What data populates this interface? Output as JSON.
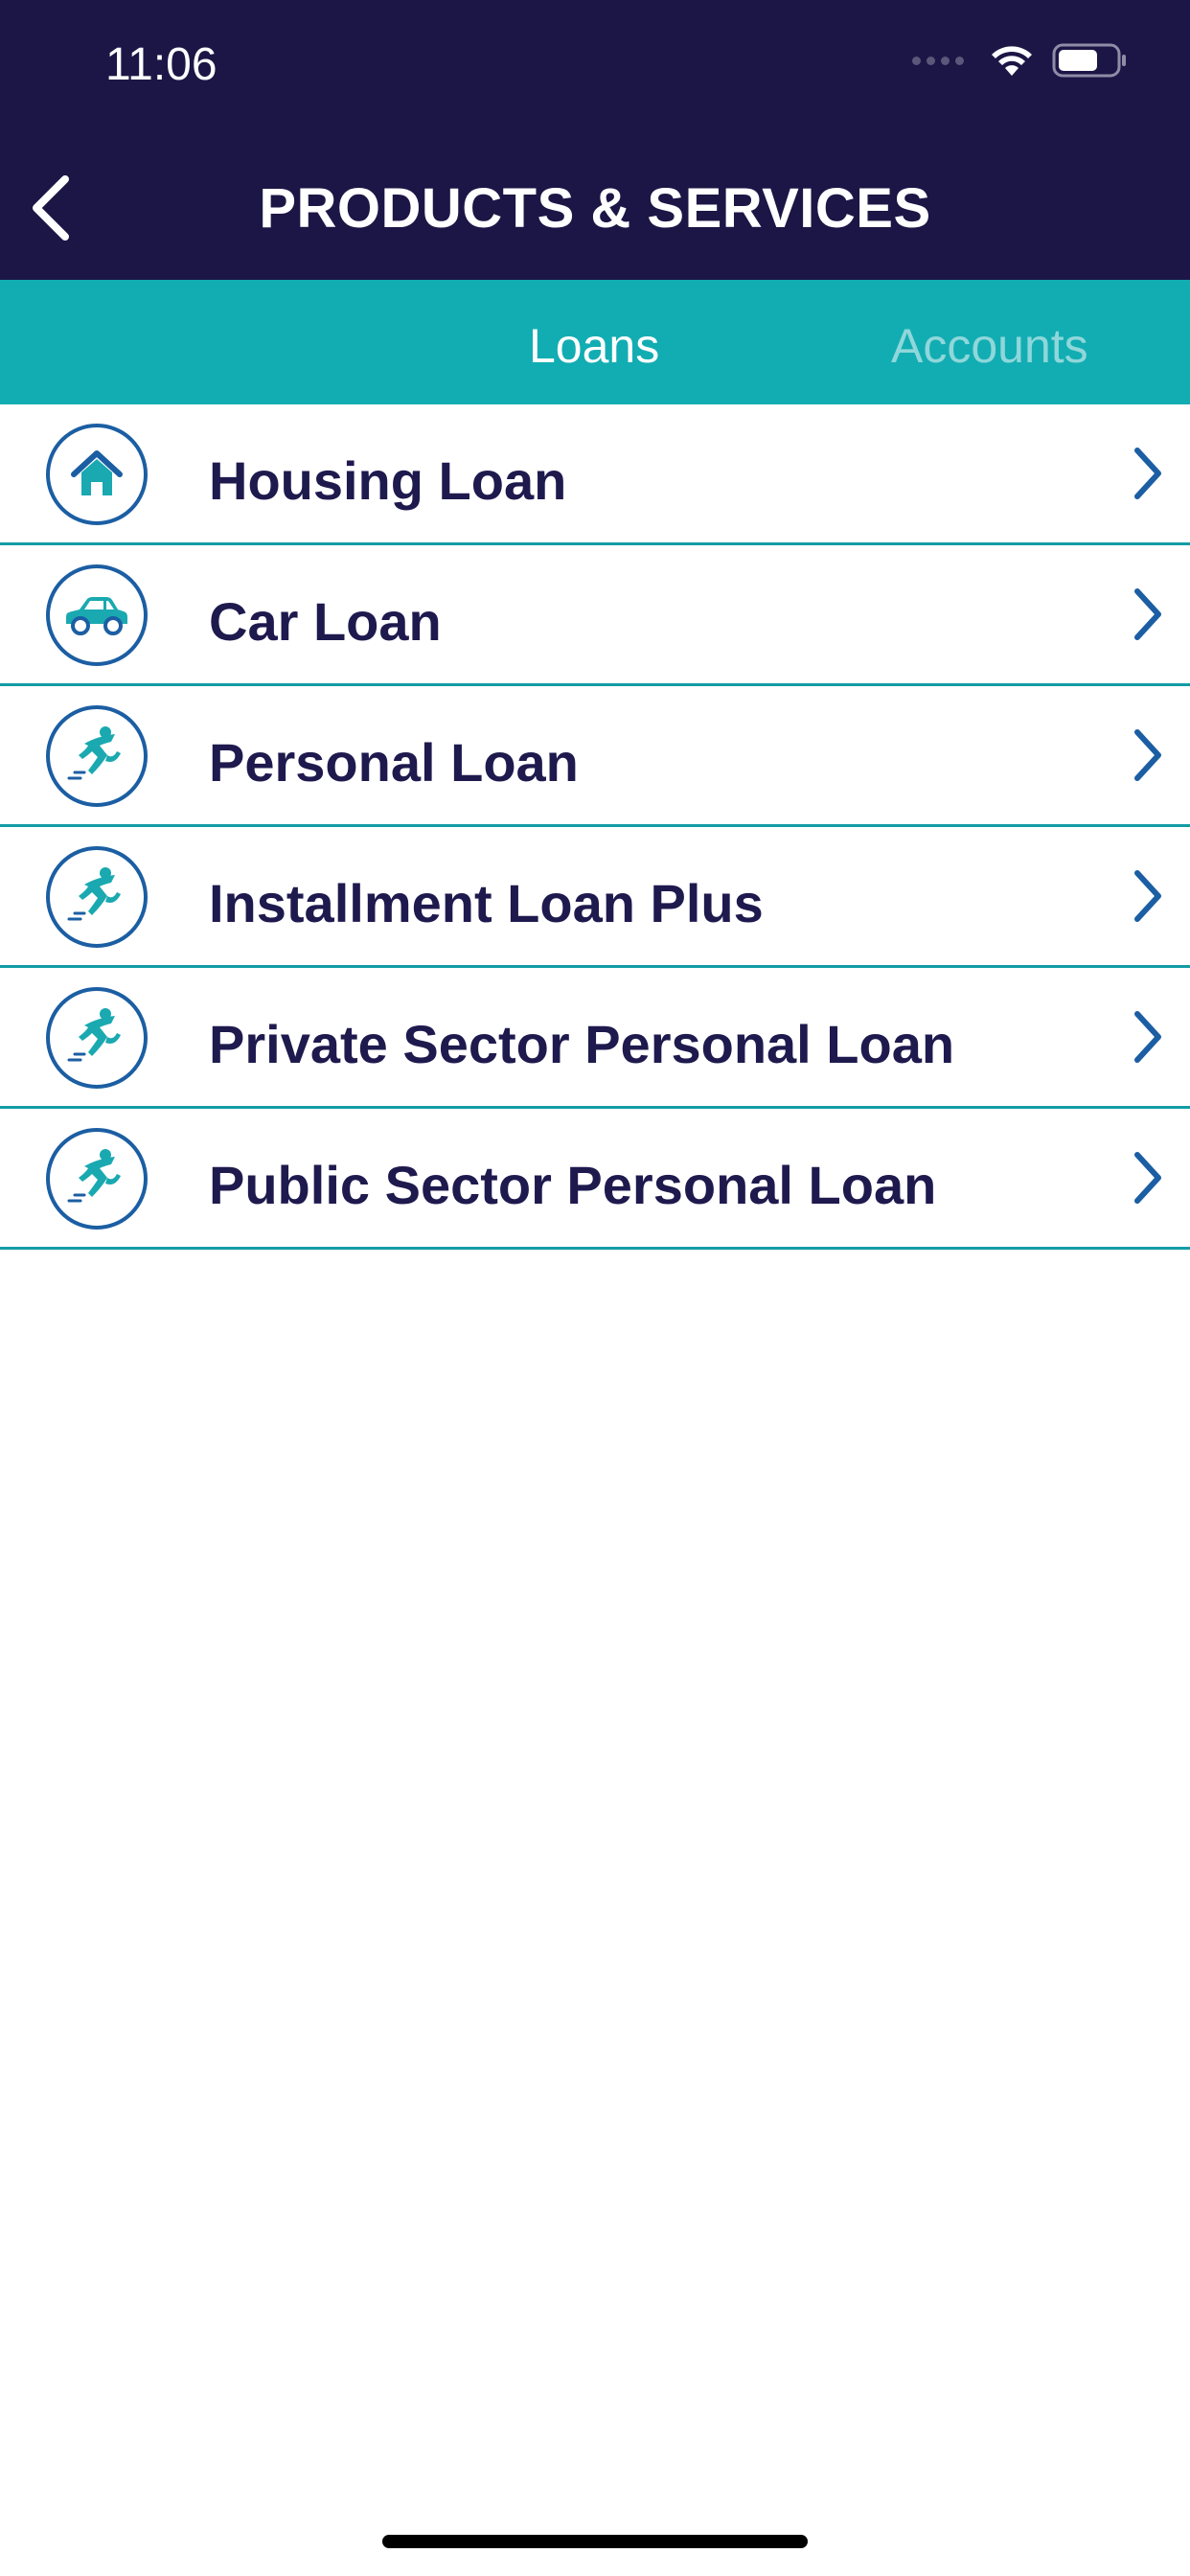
{
  "status_bar": {
    "time": "11:06"
  },
  "header": {
    "title": "PRODUCTS & SERVICES",
    "back_icon": "chevron-left-icon"
  },
  "tabs": [
    {
      "label": "Loans",
      "selected": true
    },
    {
      "label": "Accounts",
      "selected": false
    }
  ],
  "loans": [
    {
      "label": "Housing Loan",
      "icon": "house-icon"
    },
    {
      "label": "Car Loan",
      "icon": "car-icon"
    },
    {
      "label": "Personal Loan",
      "icon": "running-person-icon"
    },
    {
      "label": "Installment Loan Plus",
      "icon": "running-person-icon"
    },
    {
      "label": "Private Sector Personal Loan",
      "icon": "running-person-icon"
    },
    {
      "label": "Public Sector Personal Loan",
      "icon": "running-person-icon"
    }
  ],
  "colors": {
    "header_bg": "#1c1646",
    "tab_bg": "#12adb3",
    "tab_active": "#ffffff",
    "tab_inactive": "#8fd7da",
    "row_text": "#1e1a4e",
    "icon_ring": "#1b5ea3",
    "icon_fill": "#1aa9b0",
    "divider": "#139ca5"
  }
}
